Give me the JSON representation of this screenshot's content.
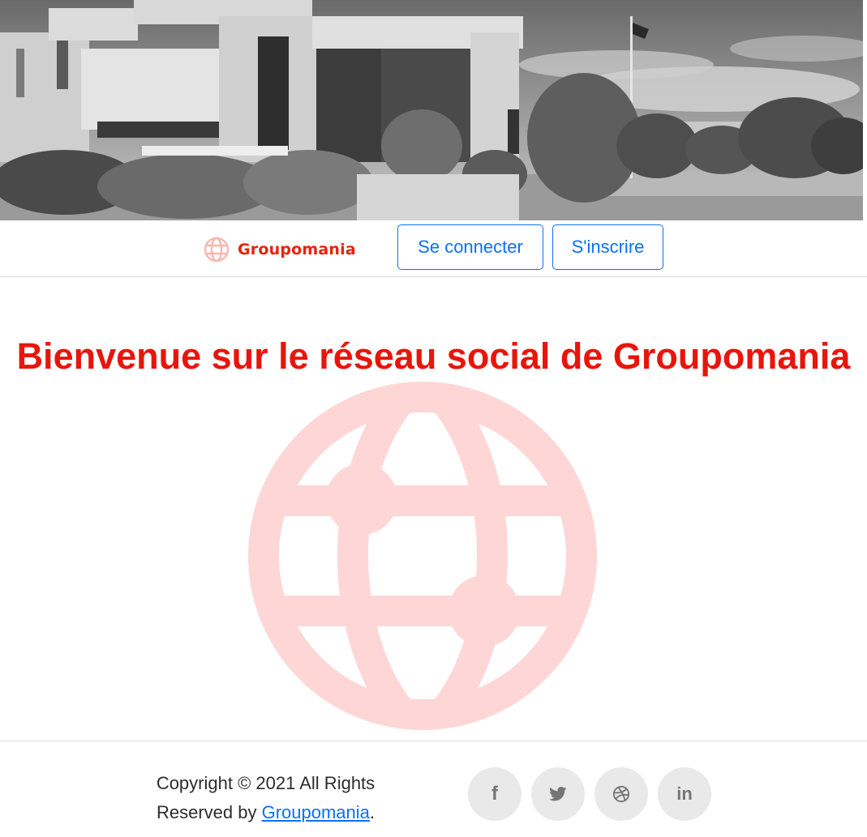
{
  "hero": {
    "image": "grayscale-photo-modern-building-with-trees-and-flagpole"
  },
  "navbar": {
    "brand_name": "Groupomania",
    "brand_icon": "globe-icon",
    "login_label": "Se connecter",
    "signup_label": "S'inscrire"
  },
  "main": {
    "welcome_title": "Bienvenue sur le réseau social de Groupomania",
    "illustration": "globe-icon"
  },
  "footer": {
    "copyright_text": "Copyright © 2021 All Rights Reserved by ",
    "copyright_link": "Groupomania",
    "copyright_end": ".",
    "social": [
      {
        "icon": "facebook-icon",
        "glyph": "f"
      },
      {
        "icon": "twitter-icon"
      },
      {
        "icon": "dribbble-icon"
      },
      {
        "icon": "linkedin-icon",
        "glyph": "in"
      }
    ]
  },
  "colors": {
    "brand_red": "#e8150b",
    "link_blue": "#0d6efd",
    "globe_pink": "#ffd6d6",
    "social_bg": "#e9e9e9"
  }
}
